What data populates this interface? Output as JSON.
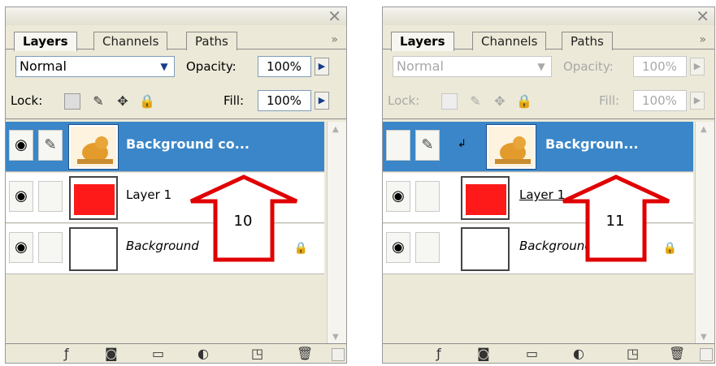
{
  "panels": [
    {
      "close_glyph": "✕",
      "tabs": [
        "Layers",
        "Channels",
        "Paths"
      ],
      "more_glyph": "»",
      "blend_mode": "Normal",
      "opacity_label": "Opacity:",
      "opacity_value": "100%",
      "lock_label": "Lock:",
      "fill_label": "Fill:",
      "fill_value": "100%",
      "layers": [
        {
          "name": "Background co...",
          "selected": true
        },
        {
          "name": "Layer 1",
          "selected": false
        },
        {
          "name": "Background",
          "selected": false
        }
      ],
      "callout": "10"
    },
    {
      "close_glyph": "✕",
      "tabs": [
        "Layers",
        "Channels",
        "Paths"
      ],
      "more_glyph": "»",
      "blend_mode": "Normal",
      "opacity_label": "Opacity:",
      "opacity_value": "100%",
      "lock_label": "Lock:",
      "fill_label": "Fill:",
      "fill_value": "100%",
      "layers": [
        {
          "name": "Backgroun...",
          "selected": true
        },
        {
          "name": "Layer 1",
          "selected": false
        },
        {
          "name": "Background",
          "selected": false
        }
      ],
      "callout": "11"
    }
  ],
  "colors": {
    "selection": "#3a86c8",
    "arrow": "#e00000",
    "panel_bg": "#ECE9D8"
  },
  "icons": [
    "eye-icon",
    "brush-icon",
    "lock-icon",
    "fx-icon",
    "mask-icon",
    "folder-icon",
    "adjustment-icon",
    "new-layer-icon",
    "trash-icon"
  ]
}
